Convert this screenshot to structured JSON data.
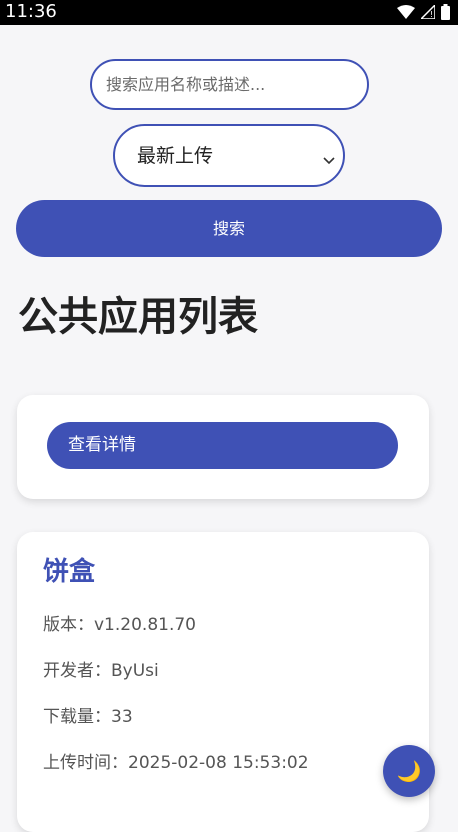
{
  "status_bar": {
    "time": "11:36",
    "icons": [
      "wifi-icon",
      "signal-icon",
      "battery-icon"
    ]
  },
  "search": {
    "placeholder": "搜索应用名称或描述...",
    "value": ""
  },
  "sort": {
    "selected": "最新上传",
    "options": [
      "最新上传"
    ]
  },
  "search_button": {
    "label": "搜索"
  },
  "section": {
    "title": "公共应用列表"
  },
  "cards": [
    {
      "details_button": "查看详情"
    },
    {
      "name": "饼盒",
      "version": "版本：v1.20.81.70",
      "developer": "开发者：ByUsi",
      "downloads": "下载量：33",
      "uploaded": "上传时间：2025-02-08 15:53:02"
    }
  ],
  "fab": {
    "icon": "moon-icon",
    "glyph": "🌙"
  },
  "colors": {
    "accent": "#3f51b5",
    "background": "#f6f6f8",
    "card": "#ffffff",
    "status_bar": "#000000"
  }
}
